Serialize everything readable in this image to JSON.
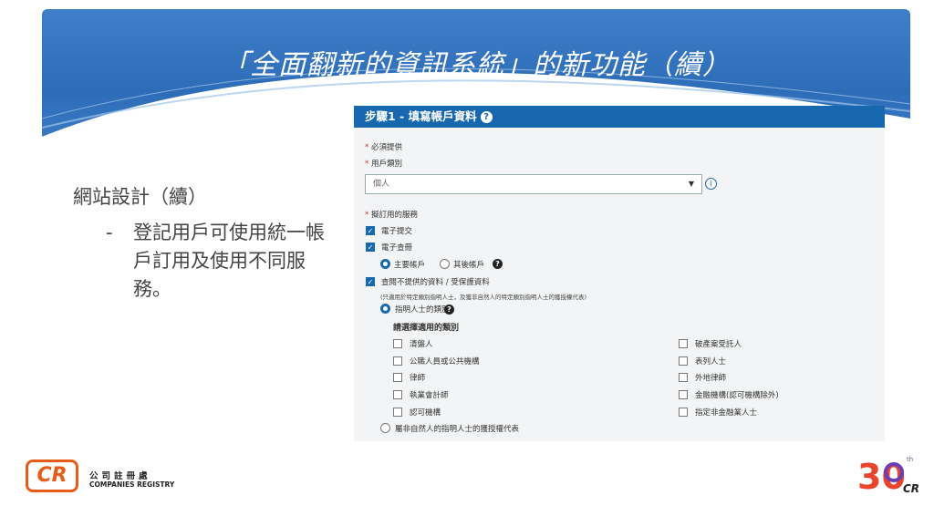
{
  "slide_title": "「全面翻新的資訊系統」的新功能（續）",
  "left": {
    "heading": "網站設計（續）",
    "bullet_dash": "-",
    "bullet_text": "登記用戶可使用統一帳戶訂用及使用不同服務。"
  },
  "form": {
    "header": "步驟1 - 填寫帳戶資料",
    "required_note": "必須提供",
    "account_type_label": "用戶類別",
    "account_type_value": "個人",
    "services_label": "擬訂用的服務",
    "services": [
      {
        "label": "電子提交",
        "checked": true
      },
      {
        "label": "電子查冊",
        "checked": true
      }
    ],
    "account_options": [
      {
        "label": "主要帳戶",
        "selected": true
      },
      {
        "label": "其後帳戶",
        "selected": false
      }
    ],
    "restricted_service": {
      "label": "查閱不提供的資料 / 受保護資料",
      "checked": true
    },
    "restricted_note": "(只適用於特定類別指明人士，及獲非自然人的特定類別指明人士的獲授權代表)",
    "specified_person_option": "指明人士的類別",
    "choose_category": "請選擇適用的類別",
    "categories_left": [
      "清盤人",
      "公職人員或公共機構",
      "律師",
      "執業會計師",
      "認可機構"
    ],
    "categories_right": [
      "破產案受託人",
      "表列人士",
      "外地律師",
      "金融機構(認可機構除外)",
      "指定非金融業人士"
    ],
    "authorized_rep_option": "屬非自然人的指明人士的獲授權代表"
  },
  "footer": {
    "logo_text": "CR",
    "org_cn": "公司註冊處",
    "org_en": "COMPANIES REGISTRY",
    "badge_number": "30",
    "badge_suffix": "th",
    "badge_cr": "CR"
  }
}
